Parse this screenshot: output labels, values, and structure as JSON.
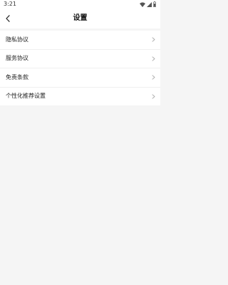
{
  "status_bar": {
    "time": "3:21"
  },
  "header": {
    "title": "设置"
  },
  "menu": {
    "items": [
      {
        "label": "隐私协议"
      },
      {
        "label": "服务协议"
      },
      {
        "label": "免责条款"
      },
      {
        "label": "个性化推荐设置"
      }
    ]
  },
  "icons": {
    "status": [
      "wifi-icon",
      "signal-icon",
      "battery-icon"
    ],
    "back": "back-arrow-icon",
    "row_chevron": "chevron-right-icon"
  },
  "colors": {
    "page_background": "#f5f5f5",
    "surface": "#ffffff",
    "text_primary": "#222222",
    "chevron": "#aaaaaa"
  }
}
